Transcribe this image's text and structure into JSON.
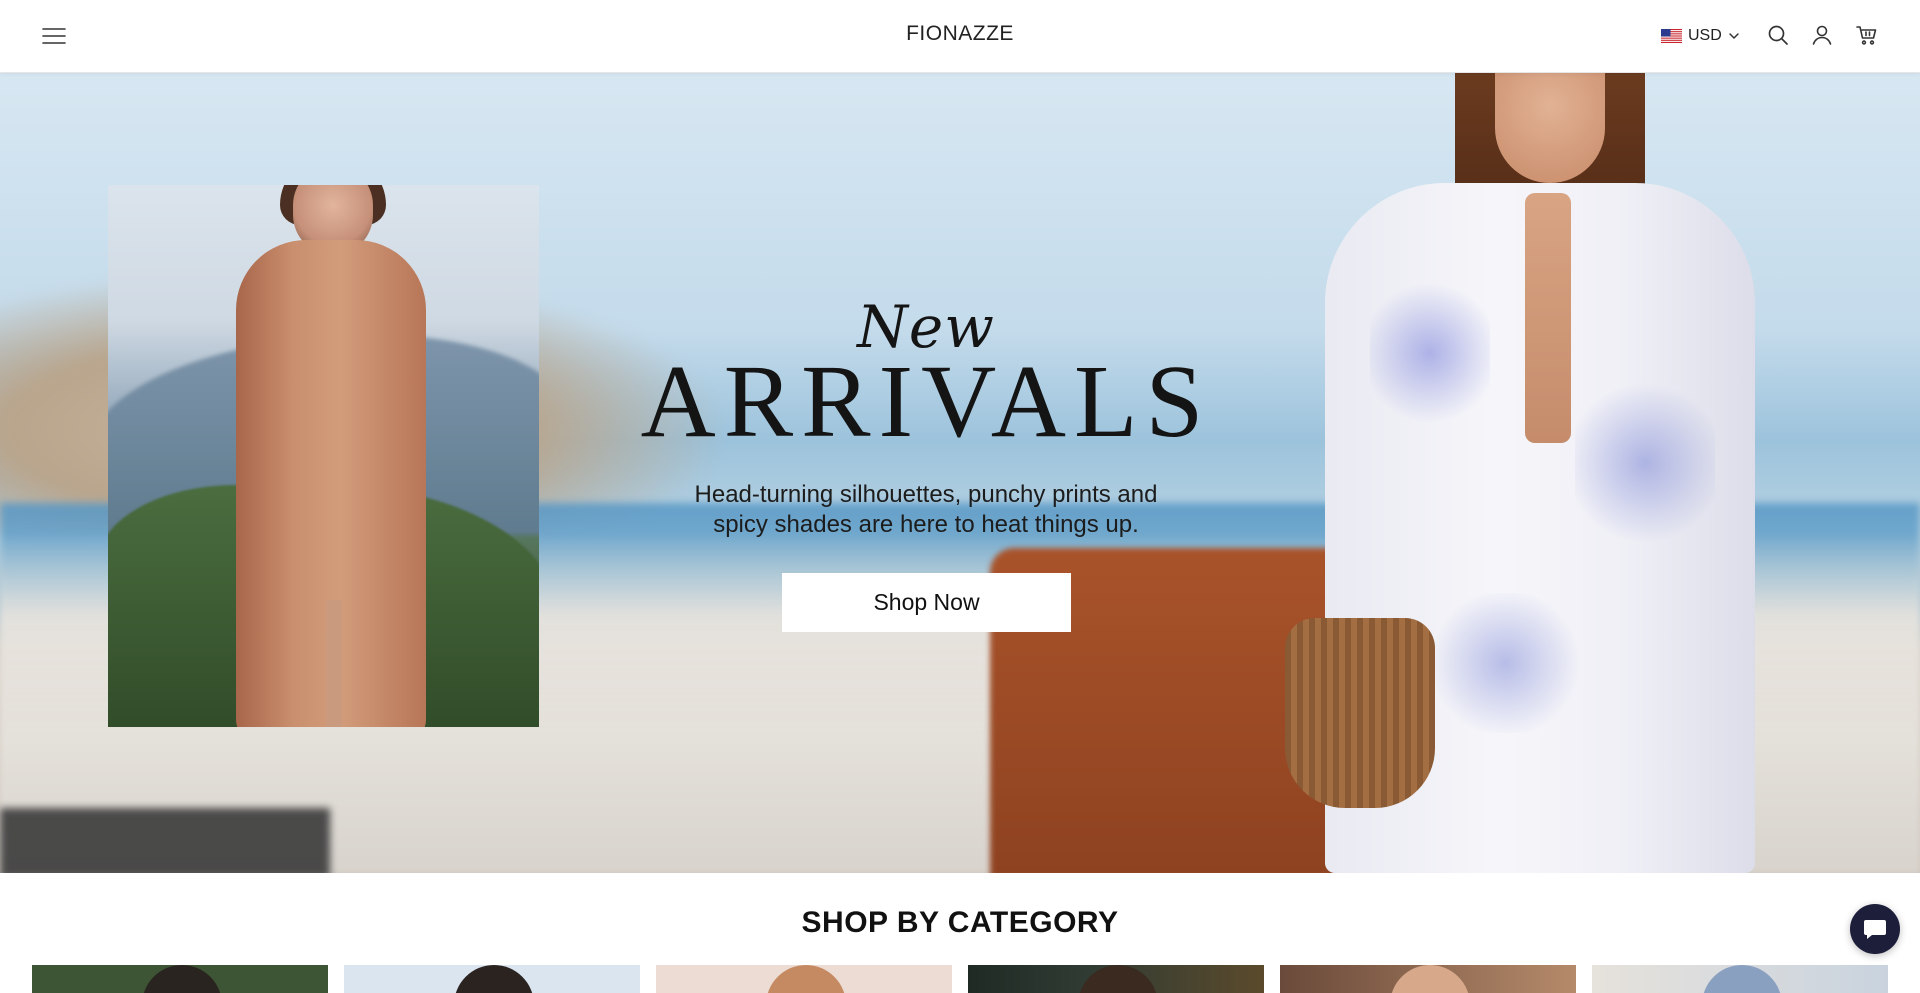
{
  "header": {
    "brand": "FIONAZZE",
    "currency": "USD",
    "icons": [
      "menu-icon",
      "us-flag-icon",
      "chevron-down-icon",
      "search-icon",
      "account-icon",
      "cart-icon"
    ]
  },
  "hero": {
    "script_word": "New",
    "headline": "ARRIVALS",
    "subtitle_line1": "Head-turning silhouettes, punchy prints and",
    "subtitle_line2": "spicy shades are here to heat things up.",
    "cta_label": "Shop Now"
  },
  "categories": {
    "title": "SHOP BY CATEGORY",
    "cards": [
      {
        "tone": "#2f3e2a"
      },
      {
        "tone": "#d9e3ef"
      },
      {
        "tone": "#e9d8d0"
      },
      {
        "tone": "#3a2f25"
      },
      {
        "tone": "#b57a52"
      },
      {
        "tone": "#e3e1dc"
      }
    ]
  },
  "chat": {
    "icon": "chat-bubble-icon"
  },
  "colors": {
    "accent_dark": "#1d1e3a",
    "text": "#141414",
    "cta_bg": "#ffffff"
  }
}
